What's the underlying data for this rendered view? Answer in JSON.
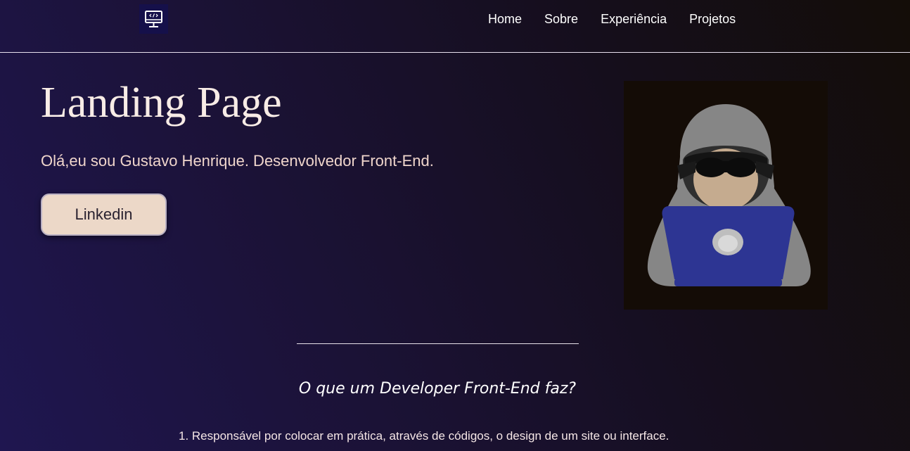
{
  "nav": {
    "logo_icon": "monitor-code-icon",
    "links": [
      "Home",
      "Sobre",
      "Experiência",
      "Projetos"
    ]
  },
  "hero": {
    "title": "Landing Page",
    "subtitle": "Olá,eu sou Gustavo Henrique. Desenvolvedor Front-End.",
    "button_label": "Linkedin",
    "illustration": "hooded-developer-laptop-illustration"
  },
  "section": {
    "title": "O que um Developer Front-End faz?",
    "items": [
      "1. Responsável por colocar em prática, através de códigos, o design de um site ou interface."
    ]
  },
  "colors": {
    "button_bg": "#ecd8c8",
    "logo_bg": "#15104a",
    "laptop": "#2d3593",
    "hood": "#858585"
  }
}
